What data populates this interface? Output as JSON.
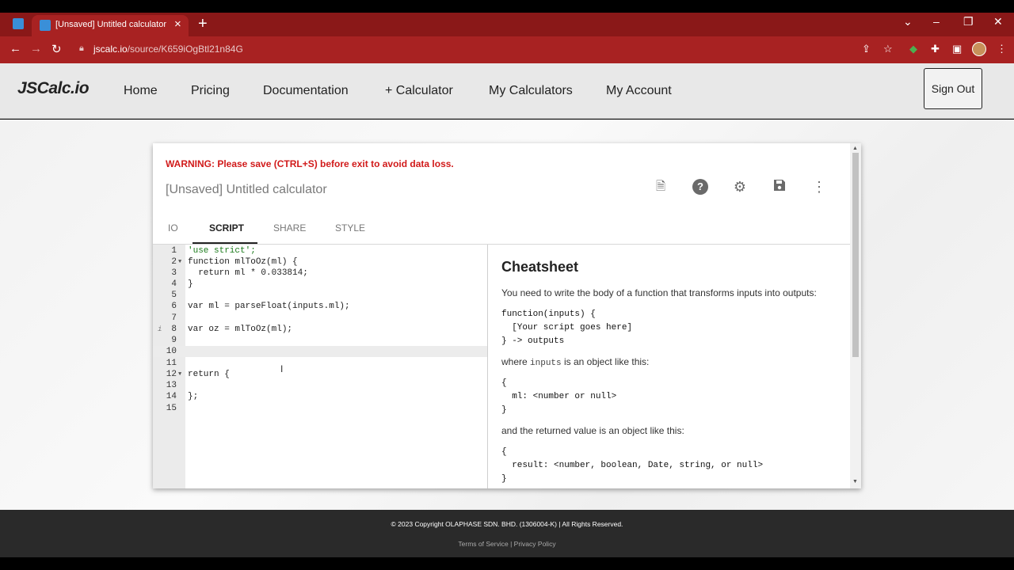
{
  "browser": {
    "tab_title": "[Unsaved] Untitled calculator - J",
    "url_host": "jscalc.io",
    "url_path": "/source/K659iOgBtl21n84G"
  },
  "site": {
    "logo": "JSCalc.io",
    "nav": [
      "Home",
      "Pricing",
      "Documentation",
      "+ Calculator",
      "My Calculators",
      "My Account"
    ],
    "sign_out": "Sign Out"
  },
  "editor": {
    "warning": "WARNING: Please save (CTRL+S) before exit to avoid data loss.",
    "title": "[Unsaved] Untitled calculator",
    "icons": [
      "export-icon",
      "help-icon",
      "settings-icon",
      "save-icon",
      "more-icon"
    ],
    "tabs": [
      "IO",
      "SCRIPT",
      "SHARE",
      "STYLE"
    ],
    "active_tab": "SCRIPT",
    "line_numbers": [
      "1",
      "2",
      "3",
      "4",
      "5",
      "6",
      "7",
      "8",
      "9",
      "10",
      "11",
      "12",
      "13",
      "14",
      "15"
    ],
    "code_lines": [
      "'use strict';",
      "function mlToOz(ml) {",
      "  return ml * 0.033814;",
      "}",
      "",
      "var ml = parseFloat(inputs.ml);",
      "",
      "var oz = mlToOz(ml);",
      "",
      "",
      "",
      "return {",
      "",
      "};",
      ""
    ]
  },
  "cheatsheet": {
    "title": "Cheatsheet",
    "intro": "You need to write the body of a function that transforms inputs into outputs:",
    "signature_1": "function(inputs) {",
    "signature_2": "  [Your script goes here]",
    "signature_3": "} -> outputs",
    "where_pre": "where",
    "where_code": "inputs",
    "where_post": "is an object like this:",
    "inputs_1": "{",
    "inputs_2": "  ml: <number or null>",
    "inputs_3": "}",
    "returned": "and the returned value is an object like this:",
    "outputs_1": "{",
    "outputs_2": "  result: <number, boolean, Date, string, or null>",
    "outputs_3": "}"
  },
  "footer": {
    "copyright": "© 2023 Copyright OLAPHASE SDN. BHD. (1306004-K) | All Rights Reserved.",
    "terms": "Terms of Service",
    "separator": "|",
    "privacy": "Privacy Policy"
  }
}
